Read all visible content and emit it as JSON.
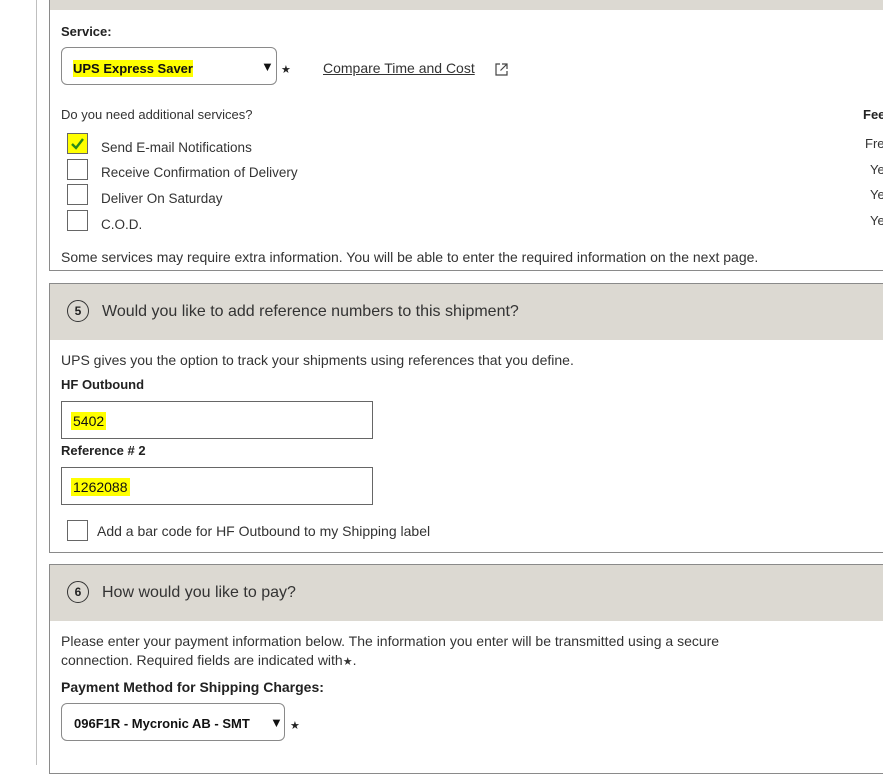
{
  "service": {
    "label": "Service:",
    "selected": "UPS Express Saver",
    "required_mark": "★",
    "compare_link": "Compare Time and Cost"
  },
  "additional": {
    "question": "Do you need additional services?",
    "fee_header": "Fee",
    "options": [
      {
        "label": "Send E-mail Notifications",
        "checked": true,
        "fee": "Fre"
      },
      {
        "label": "Receive Confirmation of Delivery",
        "checked": false,
        "fee": "Ye"
      },
      {
        "label": "Deliver On Saturday",
        "checked": false,
        "fee": "Ye"
      },
      {
        "label": "C.O.D.",
        "checked": false,
        "fee": "Ye"
      }
    ],
    "note": "Some services may require extra information. You will be able to enter the required information on the next page."
  },
  "section5": {
    "number": "5",
    "title": "Would you like to add reference numbers to this shipment?",
    "intro": "UPS gives you the option to track your shipments using references that you define.",
    "ref1_label": "HF Outbound",
    "ref1_value": "5402",
    "ref2_label": "Reference # 2",
    "ref2_value": "1262088",
    "barcode_label": "Add a bar code for HF Outbound to my Shipping label"
  },
  "section6": {
    "number": "6",
    "title": "How would you like to pay?",
    "intro_line1": "Please enter your payment information below. The information you enter will be transmitted using a secure",
    "intro_line2": "connection. Required fields are indicated with",
    "required_mark": "★",
    "method_label": "Payment Method for Shipping Charges:",
    "method_value": "096F1R - Mycronic AB - SMT"
  },
  "colors": {
    "highlight": "#ffff00",
    "header_band": "#dcd9d2",
    "border": "#8a8a8a",
    "check": "#2a8a1a"
  }
}
